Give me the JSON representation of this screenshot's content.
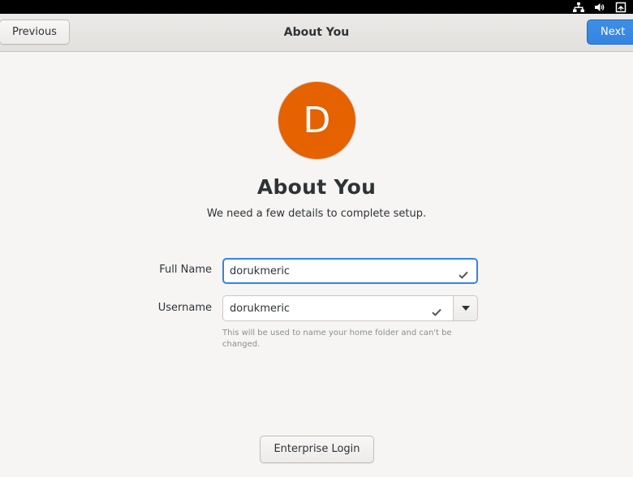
{
  "topbar": {
    "tray_icons": [
      "network-wired-icon",
      "audio-volume-icon",
      "power-icon"
    ]
  },
  "header": {
    "title": "About You",
    "previous_label": "Previous",
    "next_label": "Next"
  },
  "avatar": {
    "letter": "D",
    "color": "#e66100"
  },
  "page": {
    "title": "About You",
    "subtitle": "We need a few details to complete setup."
  },
  "form": {
    "full_name": {
      "label": "Full Name",
      "value": "dorukmeric",
      "valid_icon": "check-icon",
      "focused": true
    },
    "username": {
      "label": "Username",
      "value": "dorukmeric",
      "valid_icon": "check-icon",
      "dropdown_icon": "triangle-down-icon",
      "hint": "This will be used to name your home folder and can't be changed."
    }
  },
  "footer": {
    "enterprise_login_label": "Enterprise Login"
  },
  "colors": {
    "accent": "#3584e4",
    "avatar": "#e66100",
    "background": "#f6f5f4"
  }
}
